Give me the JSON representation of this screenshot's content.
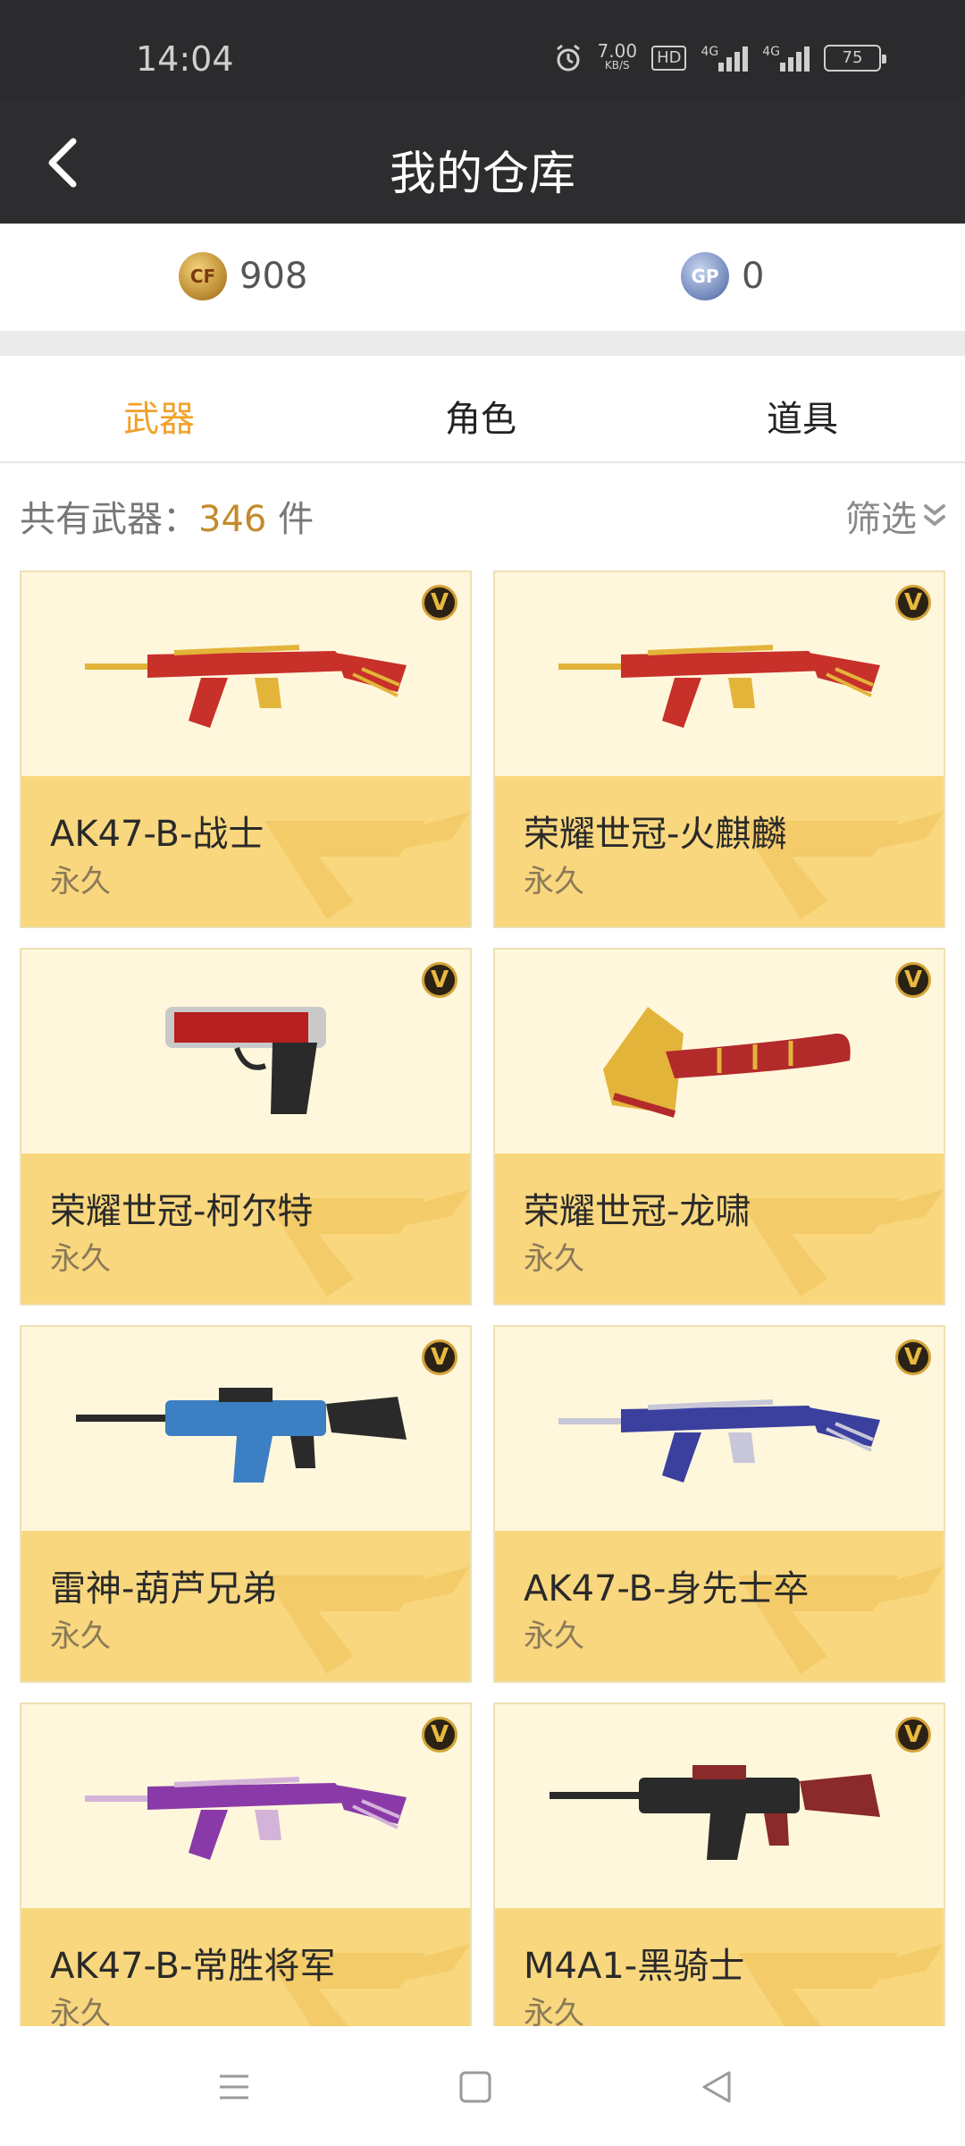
{
  "status_bar": {
    "time": "14:04",
    "speed_value": "7.00",
    "speed_unit": "KB/S",
    "hd": "HD",
    "net1": "4G",
    "net2": "4G",
    "battery": "75"
  },
  "header": {
    "title": "我的仓库",
    "back_icon": "chevron-left-icon"
  },
  "currency": {
    "cf_points": "908",
    "gp_points": "0",
    "cf_icon_label": "CF",
    "gp_icon_label": "GP"
  },
  "tabs": [
    {
      "label": "武器",
      "active": true
    },
    {
      "label": "角色",
      "active": false
    },
    {
      "label": "道具",
      "active": false
    }
  ],
  "summary": {
    "prefix": "共有武器：",
    "count": "346",
    "unit": " 件"
  },
  "filter": {
    "label": "筛选",
    "icon": "double-chevron-down-icon"
  },
  "vip_badge": "V",
  "items": [
    {
      "name": "AK47-B-战士",
      "duration": "永久",
      "weapon": "rifle",
      "color": "#c8302a",
      "accent": "#e3b43a"
    },
    {
      "name": "荣耀世冠-火麒麟",
      "duration": "永久",
      "weapon": "rifle",
      "color": "#c8302a",
      "accent": "#e3b43a"
    },
    {
      "name": "荣耀世冠-柯尔特",
      "duration": "永久",
      "weapon": "pistol",
      "color": "#b81f1f",
      "accent": "#c9c9c9"
    },
    {
      "name": "荣耀世冠-龙啸",
      "duration": "永久",
      "weapon": "axe",
      "color": "#b22a2a",
      "accent": "#e3b43a"
    },
    {
      "name": "雷神-葫芦兄弟",
      "duration": "永久",
      "weapon": "m4",
      "color": "#3c7fc2",
      "accent": "#2a2a2a"
    },
    {
      "name": "AK47-B-身先士卒",
      "duration": "永久",
      "weapon": "rifle",
      "color": "#3b3f9e",
      "accent": "#c7c7d9"
    },
    {
      "name": "AK47-B-常胜将军",
      "duration": "永久",
      "weapon": "rifle",
      "color": "#8a3aa8",
      "accent": "#d4b3d9"
    },
    {
      "name": "M4A1-黑骑士",
      "duration": "永久",
      "weapon": "m4",
      "color": "#2a2a2a",
      "accent": "#8a2a2a"
    }
  ],
  "nav": {
    "menu_icon": "menu-icon",
    "home_icon": "square-home-icon",
    "back_icon": "triangle-back-icon"
  }
}
